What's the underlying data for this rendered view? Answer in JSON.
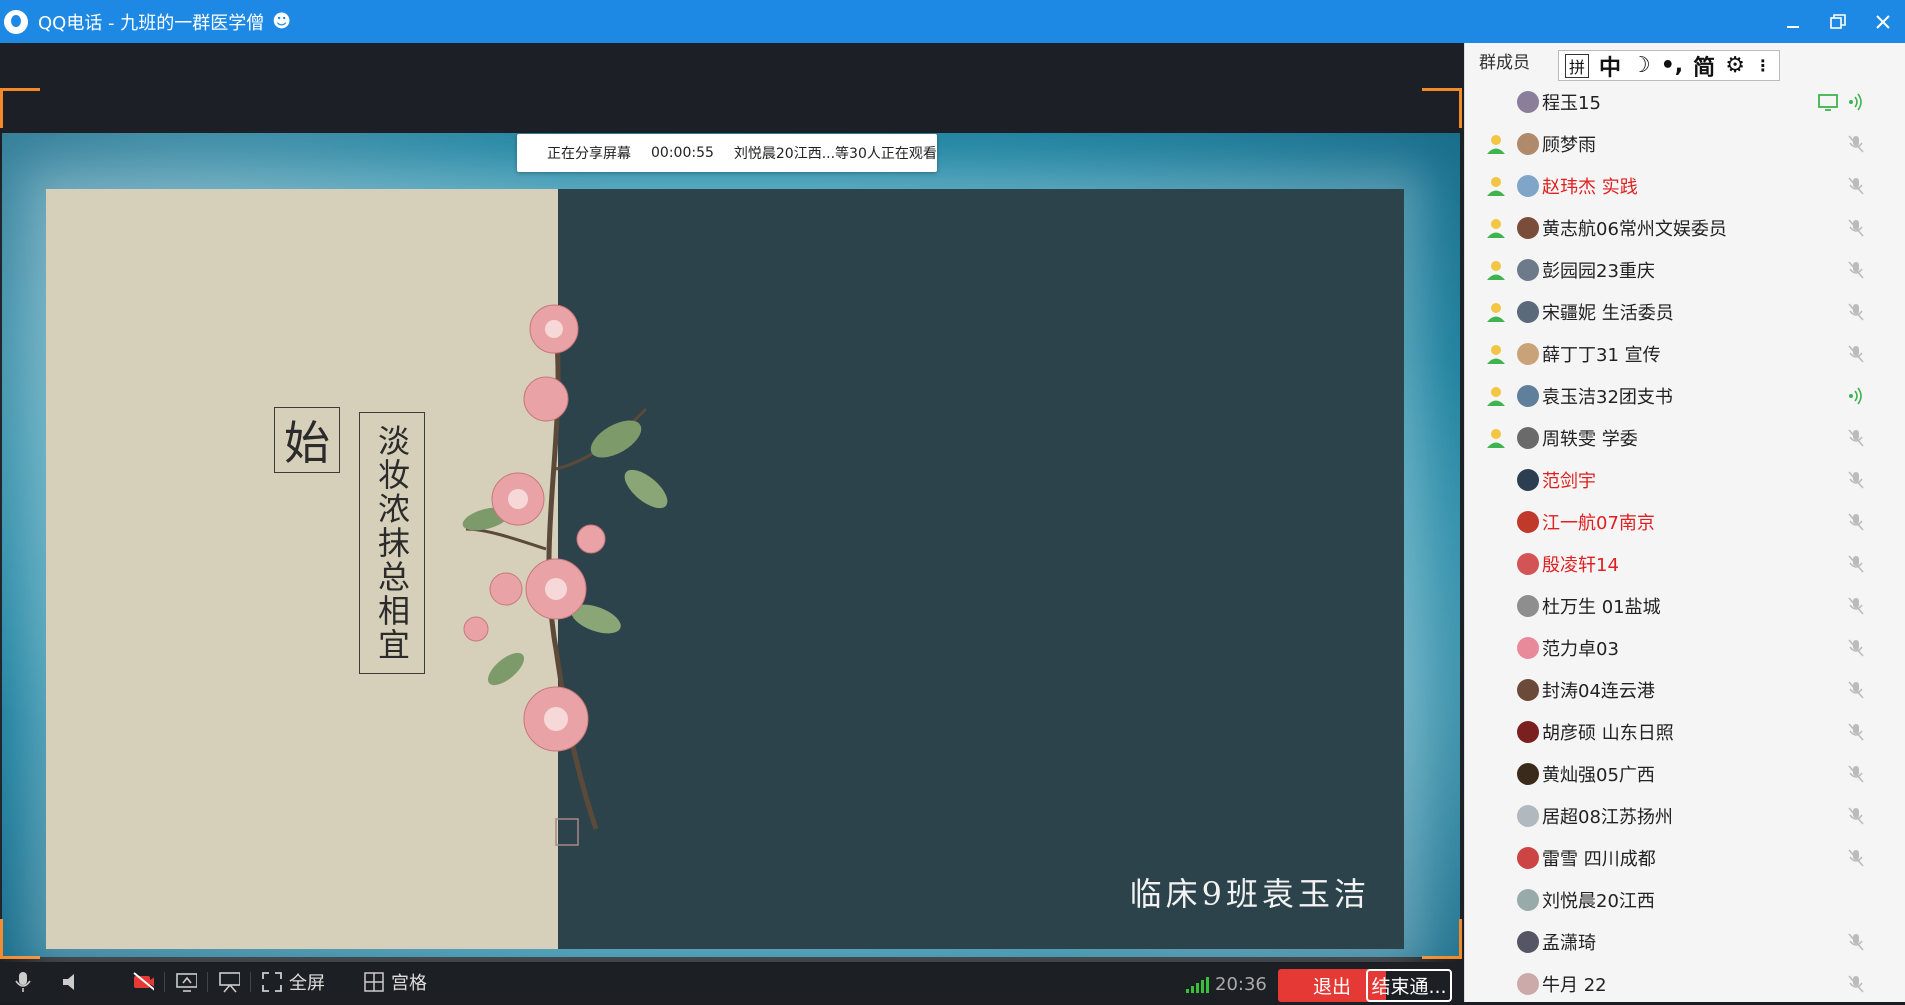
{
  "window": {
    "title": "QQ电话 - 九班的一群医学僧"
  },
  "share_status": {
    "label": "正在分享屏幕",
    "timer": "00:00:55",
    "viewers": "刘悦晨20江西...等30人正在观看"
  },
  "slide": {
    "box_char": "始",
    "poem": "淡妆浓抹总相宜",
    "signature": "临床9班袁玉洁",
    "colors": {
      "left": "#d6cfb9",
      "right": "#2d434b",
      "frame": "#2b97b3"
    }
  },
  "toolbar": {
    "fullscreen_label": "全屏",
    "grid_label": "宫格",
    "time": "20:36",
    "exit_label": "退出",
    "end_label": "结束通..."
  },
  "panel": {
    "header": "群成员",
    "ime": {
      "box": "拼",
      "mode": "中",
      "simplified": "简"
    },
    "members": [
      {
        "name": "程玉15",
        "red": false,
        "role": false,
        "status": "speaking",
        "sharing": true
      },
      {
        "name": "顾梦雨",
        "red": false,
        "role": true,
        "status": "muted",
        "sharing": false
      },
      {
        "name": "赵玮杰 实践",
        "red": true,
        "role": true,
        "status": "muted",
        "sharing": false
      },
      {
        "name": "黄志航06常州文娱委员",
        "red": false,
        "role": true,
        "status": "muted",
        "sharing": false
      },
      {
        "name": "彭园园23重庆",
        "red": false,
        "role": true,
        "status": "muted",
        "sharing": false
      },
      {
        "name": "宋疆妮  生活委员",
        "red": false,
        "role": true,
        "status": "muted",
        "sharing": false
      },
      {
        "name": "薛丁丁31 宣传",
        "red": false,
        "role": true,
        "status": "muted",
        "sharing": false
      },
      {
        "name": "袁玉洁32团支书",
        "red": false,
        "role": true,
        "status": "speaking",
        "sharing": false
      },
      {
        "name": "周轶雯 学委",
        "red": false,
        "role": true,
        "status": "muted",
        "sharing": false
      },
      {
        "name": "范剑宇",
        "red": true,
        "role": false,
        "status": "muted",
        "sharing": false
      },
      {
        "name": "江一航07南京",
        "red": true,
        "role": false,
        "status": "muted",
        "sharing": false
      },
      {
        "name": "殷凌轩14",
        "red": true,
        "role": false,
        "status": "muted",
        "sharing": false
      },
      {
        "name": "杜万生 01盐城",
        "red": false,
        "role": false,
        "status": "muted",
        "sharing": false
      },
      {
        "name": "范力卓03",
        "red": false,
        "role": false,
        "status": "muted",
        "sharing": false
      },
      {
        "name": "封涛04连云港",
        "red": false,
        "role": false,
        "status": "muted",
        "sharing": false
      },
      {
        "name": "胡彦硕 山东日照",
        "red": false,
        "role": false,
        "status": "muted",
        "sharing": false
      },
      {
        "name": "黄灿强05广西",
        "red": false,
        "role": false,
        "status": "muted",
        "sharing": false
      },
      {
        "name": "居超08江苏扬州",
        "red": false,
        "role": false,
        "status": "muted",
        "sharing": false
      },
      {
        "name": "雷雪 四川成都",
        "red": false,
        "role": false,
        "status": "muted",
        "sharing": false
      },
      {
        "name": "刘悦晨20江西",
        "red": false,
        "role": false,
        "status": "none",
        "sharing": false
      },
      {
        "name": "孟潇琦",
        "red": false,
        "role": false,
        "status": "muted",
        "sharing": false
      },
      {
        "name": "牛月 22",
        "red": false,
        "role": false,
        "status": "muted",
        "sharing": false
      }
    ],
    "avatar_colors": [
      "#8a7e9b",
      "#b08a6a",
      "#7fa6c9",
      "#7a4d3a",
      "#6d7a8a",
      "#5a6a7a",
      "#c9a27a",
      "#5f7f9a",
      "#6a6a6a",
      "#2c3e50",
      "#c0392b",
      "#d35454",
      "#8e8e8e",
      "#e88a9a",
      "#6b4a3a",
      "#7a2020",
      "#3a2a1a",
      "#b0b8c0",
      "#c44",
      "#9aa",
      "#556",
      "#caa"
    ]
  }
}
